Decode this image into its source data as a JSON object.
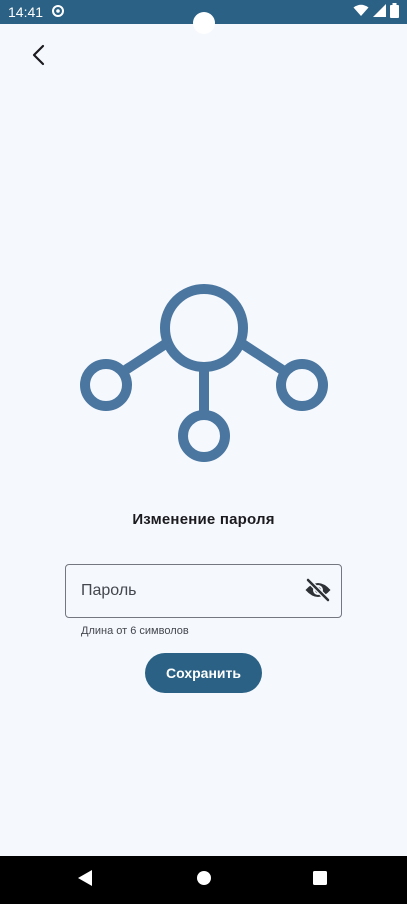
{
  "status_bar": {
    "time": "14:41",
    "icons": [
      "sync-icon",
      "wifi-icon",
      "signal-icon",
      "battery-icon"
    ]
  },
  "header": {
    "back_icon": "chevron-left-icon"
  },
  "main": {
    "logo_icon": "network-hub-icon",
    "logo_color": "#4a76a0",
    "title": "Изменение пароля",
    "password_field": {
      "placeholder": "Пароль",
      "value": "",
      "toggle_icon": "eye-off-icon"
    },
    "helper_text": "Длина от 6 символов",
    "save_label": "Сохранить"
  },
  "colors": {
    "primary": "#2a6184",
    "background": "#f5f8fd",
    "logo": "#4a76a0"
  },
  "nav_bar": {
    "icons": [
      "nav-back-icon",
      "nav-home-icon",
      "nav-recents-icon"
    ]
  }
}
